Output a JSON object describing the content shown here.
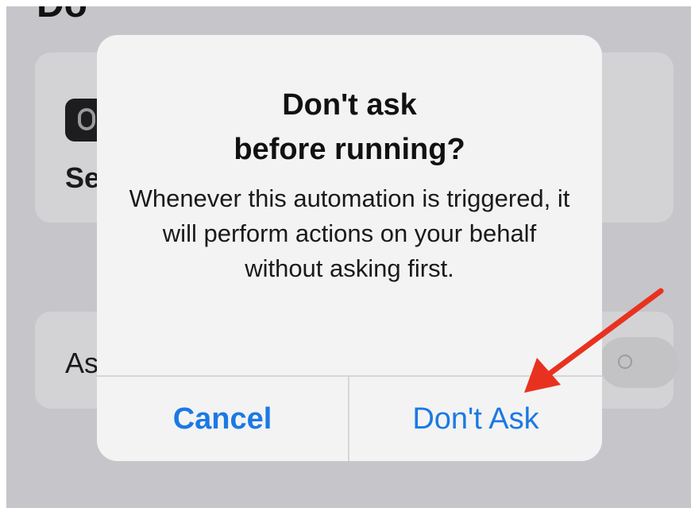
{
  "background": {
    "title_fragment": "Do",
    "row1_text_fragment": "Se",
    "row2_text_fragment": "As",
    "row1_icon": "apple-watch-icon"
  },
  "alert": {
    "title": "Don't ask\nbefore running?",
    "message": "Whenever this automation is triggered, it will perform actions on your behalf without asking first.",
    "cancel_label": "Cancel",
    "confirm_label": "Don't Ask"
  },
  "annotation": {
    "arrow_color": "#e8321f"
  },
  "colors": {
    "accent": "#1b79e4",
    "alert_background": "#f3f3f3",
    "screen_dim": "#c6c5ca"
  }
}
